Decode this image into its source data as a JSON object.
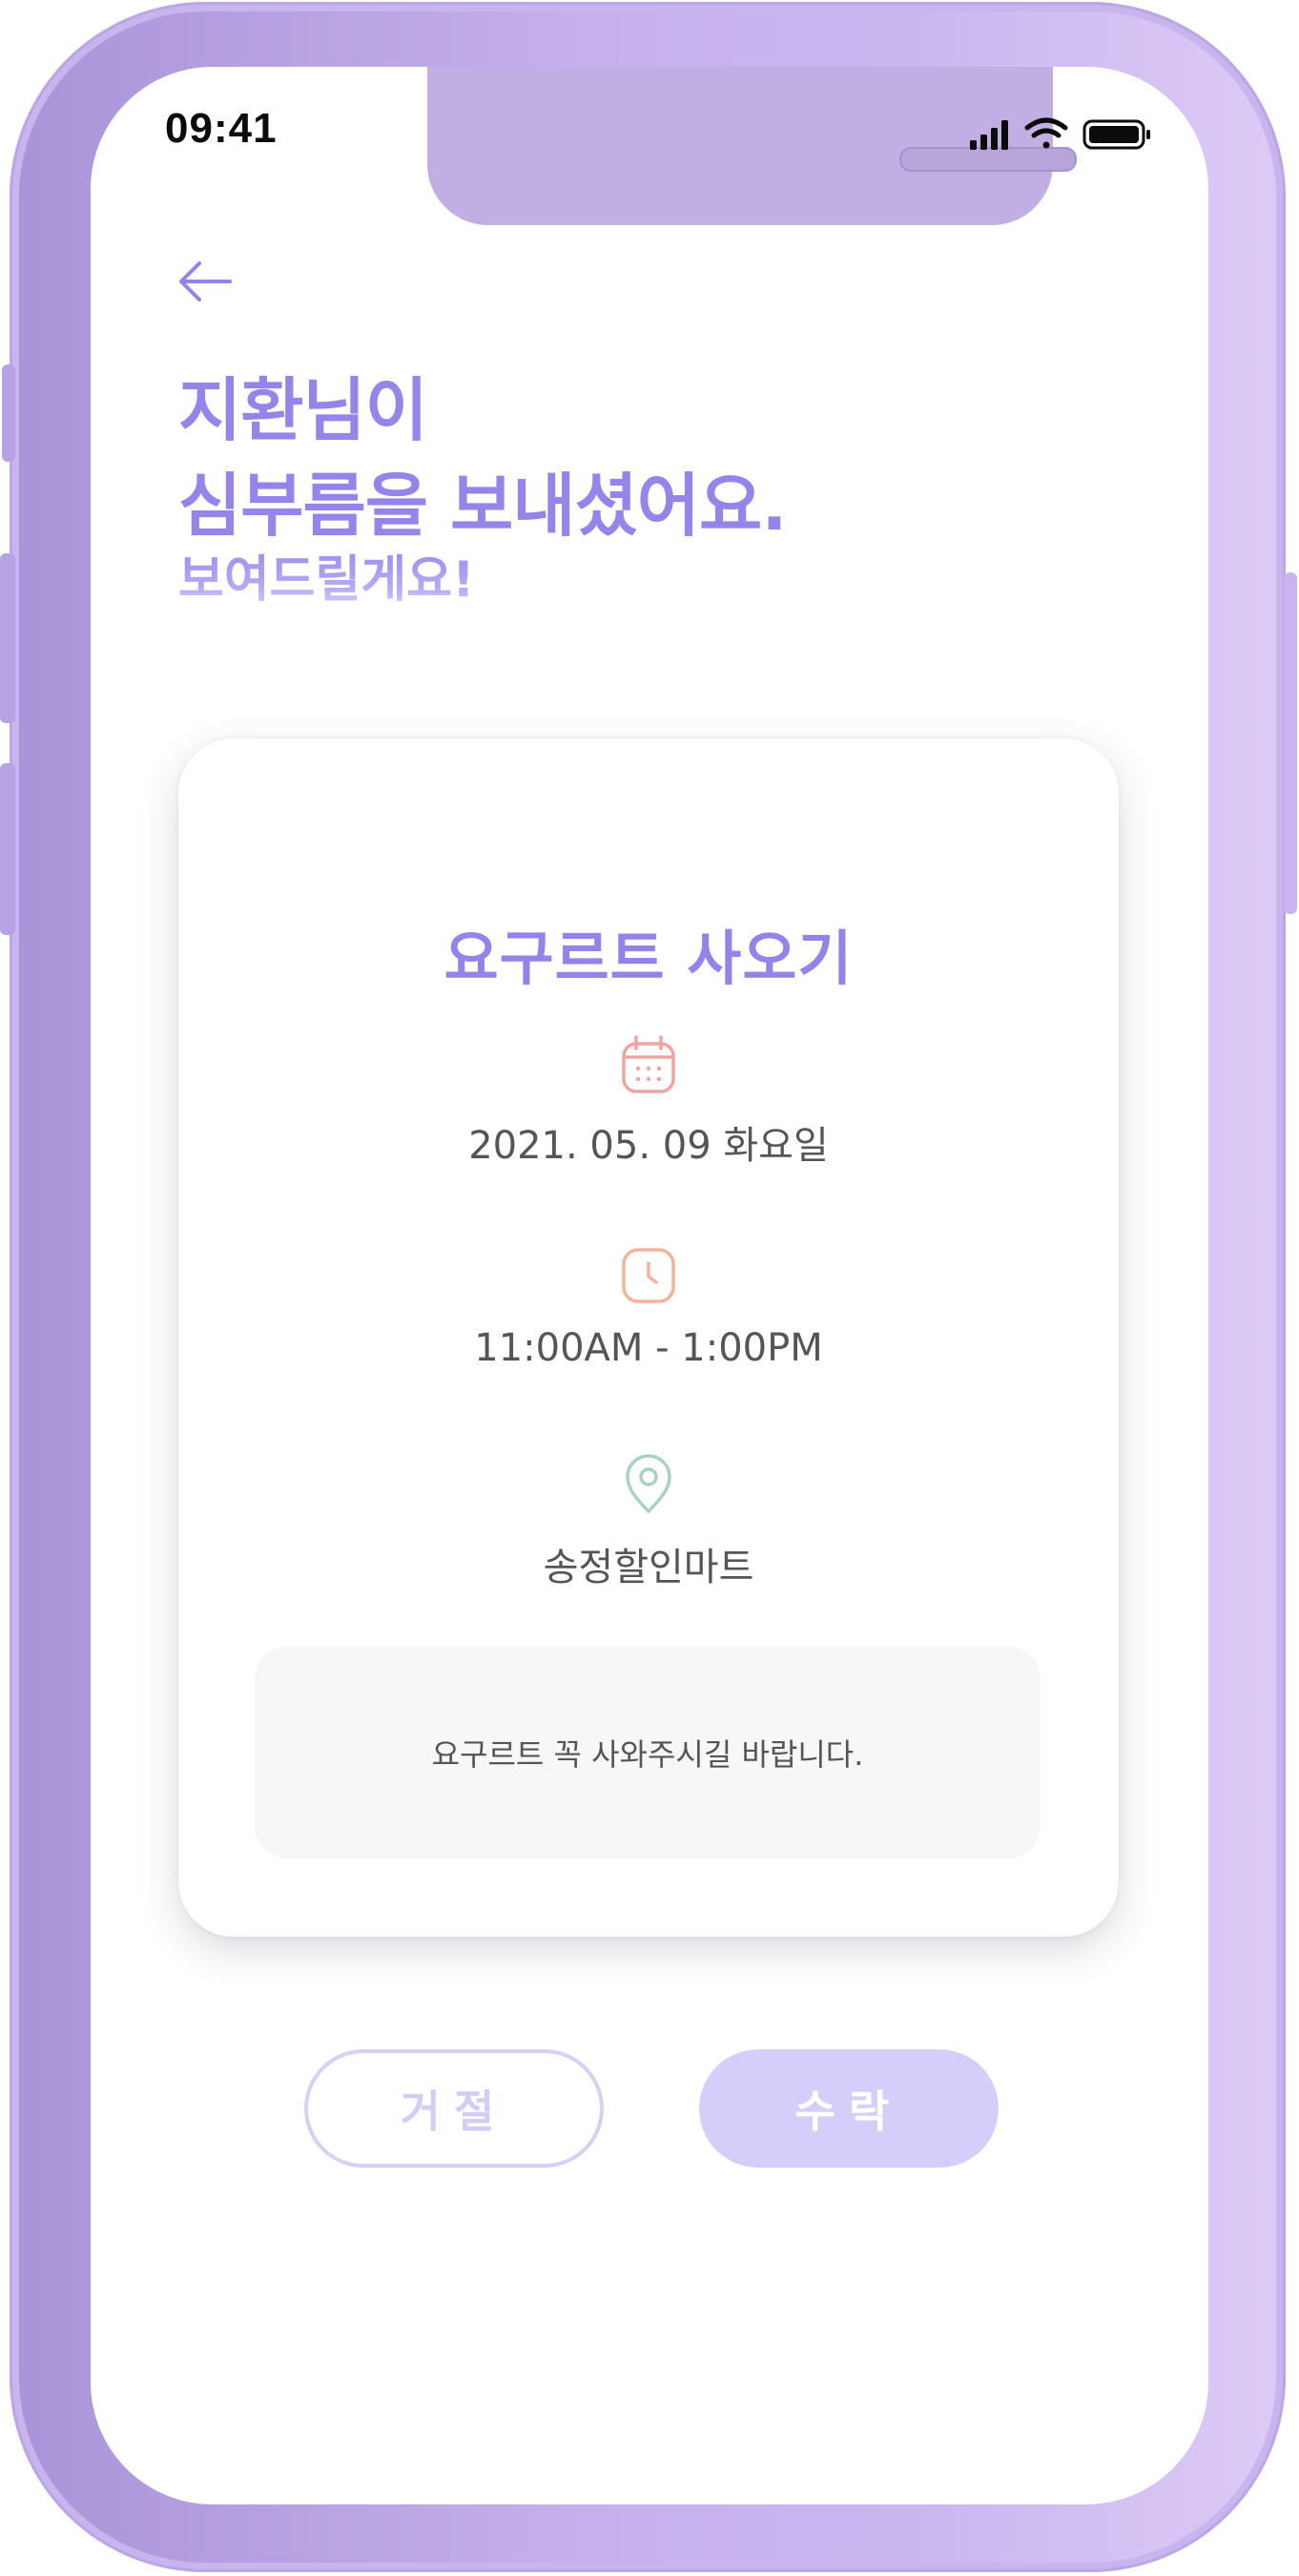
{
  "status_bar": {
    "time": "09:41",
    "icons": [
      "signal-icon",
      "wifi-icon",
      "battery-icon"
    ]
  },
  "header": {
    "back_icon": "arrow-left-icon",
    "line1": "지환님이",
    "line2": "심부름을 보내셨어요.",
    "line3": "보여드릴게요!"
  },
  "errand": {
    "title": "요구르트 사오기",
    "date": "2021. 05. 09 화요일",
    "time_range": "11:00AM - 1:00PM",
    "place": "송정할인마트",
    "memo": "요구르트 꼭 사와주시길 바랍니다.",
    "icons": {
      "date": "calendar-icon",
      "time": "clock-icon",
      "place": "location-pin-icon"
    }
  },
  "actions": {
    "reject_label": "거절",
    "accept_label": "수락"
  },
  "colors": {
    "accent": "#9584ea",
    "accept_bg": "#d4cffa",
    "reject_border": "#d6d0f6",
    "calendar_icon": "#f1a3a0",
    "clock_icon": "#f4b39a",
    "pin_icon": "#a7d2c4",
    "frame": "#c5b0ec"
  }
}
